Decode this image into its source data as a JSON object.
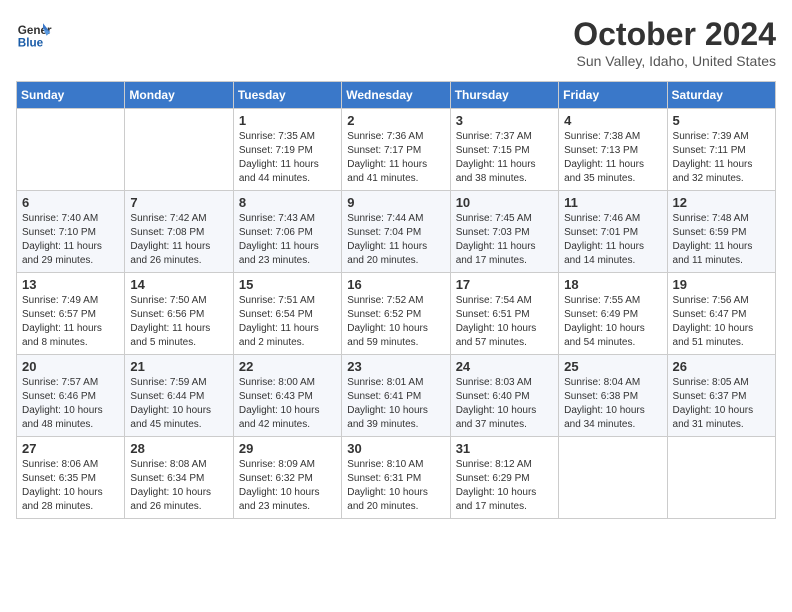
{
  "header": {
    "logo_line1": "General",
    "logo_line2": "Blue",
    "month": "October 2024",
    "location": "Sun Valley, Idaho, United States"
  },
  "days_of_week": [
    "Sunday",
    "Monday",
    "Tuesday",
    "Wednesday",
    "Thursday",
    "Friday",
    "Saturday"
  ],
  "weeks": [
    [
      {
        "day": "",
        "info": ""
      },
      {
        "day": "",
        "info": ""
      },
      {
        "day": "1",
        "info": "Sunrise: 7:35 AM\nSunset: 7:19 PM\nDaylight: 11 hours and 44 minutes."
      },
      {
        "day": "2",
        "info": "Sunrise: 7:36 AM\nSunset: 7:17 PM\nDaylight: 11 hours and 41 minutes."
      },
      {
        "day": "3",
        "info": "Sunrise: 7:37 AM\nSunset: 7:15 PM\nDaylight: 11 hours and 38 minutes."
      },
      {
        "day": "4",
        "info": "Sunrise: 7:38 AM\nSunset: 7:13 PM\nDaylight: 11 hours and 35 minutes."
      },
      {
        "day": "5",
        "info": "Sunrise: 7:39 AM\nSunset: 7:11 PM\nDaylight: 11 hours and 32 minutes."
      }
    ],
    [
      {
        "day": "6",
        "info": "Sunrise: 7:40 AM\nSunset: 7:10 PM\nDaylight: 11 hours and 29 minutes."
      },
      {
        "day": "7",
        "info": "Sunrise: 7:42 AM\nSunset: 7:08 PM\nDaylight: 11 hours and 26 minutes."
      },
      {
        "day": "8",
        "info": "Sunrise: 7:43 AM\nSunset: 7:06 PM\nDaylight: 11 hours and 23 minutes."
      },
      {
        "day": "9",
        "info": "Sunrise: 7:44 AM\nSunset: 7:04 PM\nDaylight: 11 hours and 20 minutes."
      },
      {
        "day": "10",
        "info": "Sunrise: 7:45 AM\nSunset: 7:03 PM\nDaylight: 11 hours and 17 minutes."
      },
      {
        "day": "11",
        "info": "Sunrise: 7:46 AM\nSunset: 7:01 PM\nDaylight: 11 hours and 14 minutes."
      },
      {
        "day": "12",
        "info": "Sunrise: 7:48 AM\nSunset: 6:59 PM\nDaylight: 11 hours and 11 minutes."
      }
    ],
    [
      {
        "day": "13",
        "info": "Sunrise: 7:49 AM\nSunset: 6:57 PM\nDaylight: 11 hours and 8 minutes."
      },
      {
        "day": "14",
        "info": "Sunrise: 7:50 AM\nSunset: 6:56 PM\nDaylight: 11 hours and 5 minutes."
      },
      {
        "day": "15",
        "info": "Sunrise: 7:51 AM\nSunset: 6:54 PM\nDaylight: 11 hours and 2 minutes."
      },
      {
        "day": "16",
        "info": "Sunrise: 7:52 AM\nSunset: 6:52 PM\nDaylight: 10 hours and 59 minutes."
      },
      {
        "day": "17",
        "info": "Sunrise: 7:54 AM\nSunset: 6:51 PM\nDaylight: 10 hours and 57 minutes."
      },
      {
        "day": "18",
        "info": "Sunrise: 7:55 AM\nSunset: 6:49 PM\nDaylight: 10 hours and 54 minutes."
      },
      {
        "day": "19",
        "info": "Sunrise: 7:56 AM\nSunset: 6:47 PM\nDaylight: 10 hours and 51 minutes."
      }
    ],
    [
      {
        "day": "20",
        "info": "Sunrise: 7:57 AM\nSunset: 6:46 PM\nDaylight: 10 hours and 48 minutes."
      },
      {
        "day": "21",
        "info": "Sunrise: 7:59 AM\nSunset: 6:44 PM\nDaylight: 10 hours and 45 minutes."
      },
      {
        "day": "22",
        "info": "Sunrise: 8:00 AM\nSunset: 6:43 PM\nDaylight: 10 hours and 42 minutes."
      },
      {
        "day": "23",
        "info": "Sunrise: 8:01 AM\nSunset: 6:41 PM\nDaylight: 10 hours and 39 minutes."
      },
      {
        "day": "24",
        "info": "Sunrise: 8:03 AM\nSunset: 6:40 PM\nDaylight: 10 hours and 37 minutes."
      },
      {
        "day": "25",
        "info": "Sunrise: 8:04 AM\nSunset: 6:38 PM\nDaylight: 10 hours and 34 minutes."
      },
      {
        "day": "26",
        "info": "Sunrise: 8:05 AM\nSunset: 6:37 PM\nDaylight: 10 hours and 31 minutes."
      }
    ],
    [
      {
        "day": "27",
        "info": "Sunrise: 8:06 AM\nSunset: 6:35 PM\nDaylight: 10 hours and 28 minutes."
      },
      {
        "day": "28",
        "info": "Sunrise: 8:08 AM\nSunset: 6:34 PM\nDaylight: 10 hours and 26 minutes."
      },
      {
        "day": "29",
        "info": "Sunrise: 8:09 AM\nSunset: 6:32 PM\nDaylight: 10 hours and 23 minutes."
      },
      {
        "day": "30",
        "info": "Sunrise: 8:10 AM\nSunset: 6:31 PM\nDaylight: 10 hours and 20 minutes."
      },
      {
        "day": "31",
        "info": "Sunrise: 8:12 AM\nSunset: 6:29 PM\nDaylight: 10 hours and 17 minutes."
      },
      {
        "day": "",
        "info": ""
      },
      {
        "day": "",
        "info": ""
      }
    ]
  ]
}
